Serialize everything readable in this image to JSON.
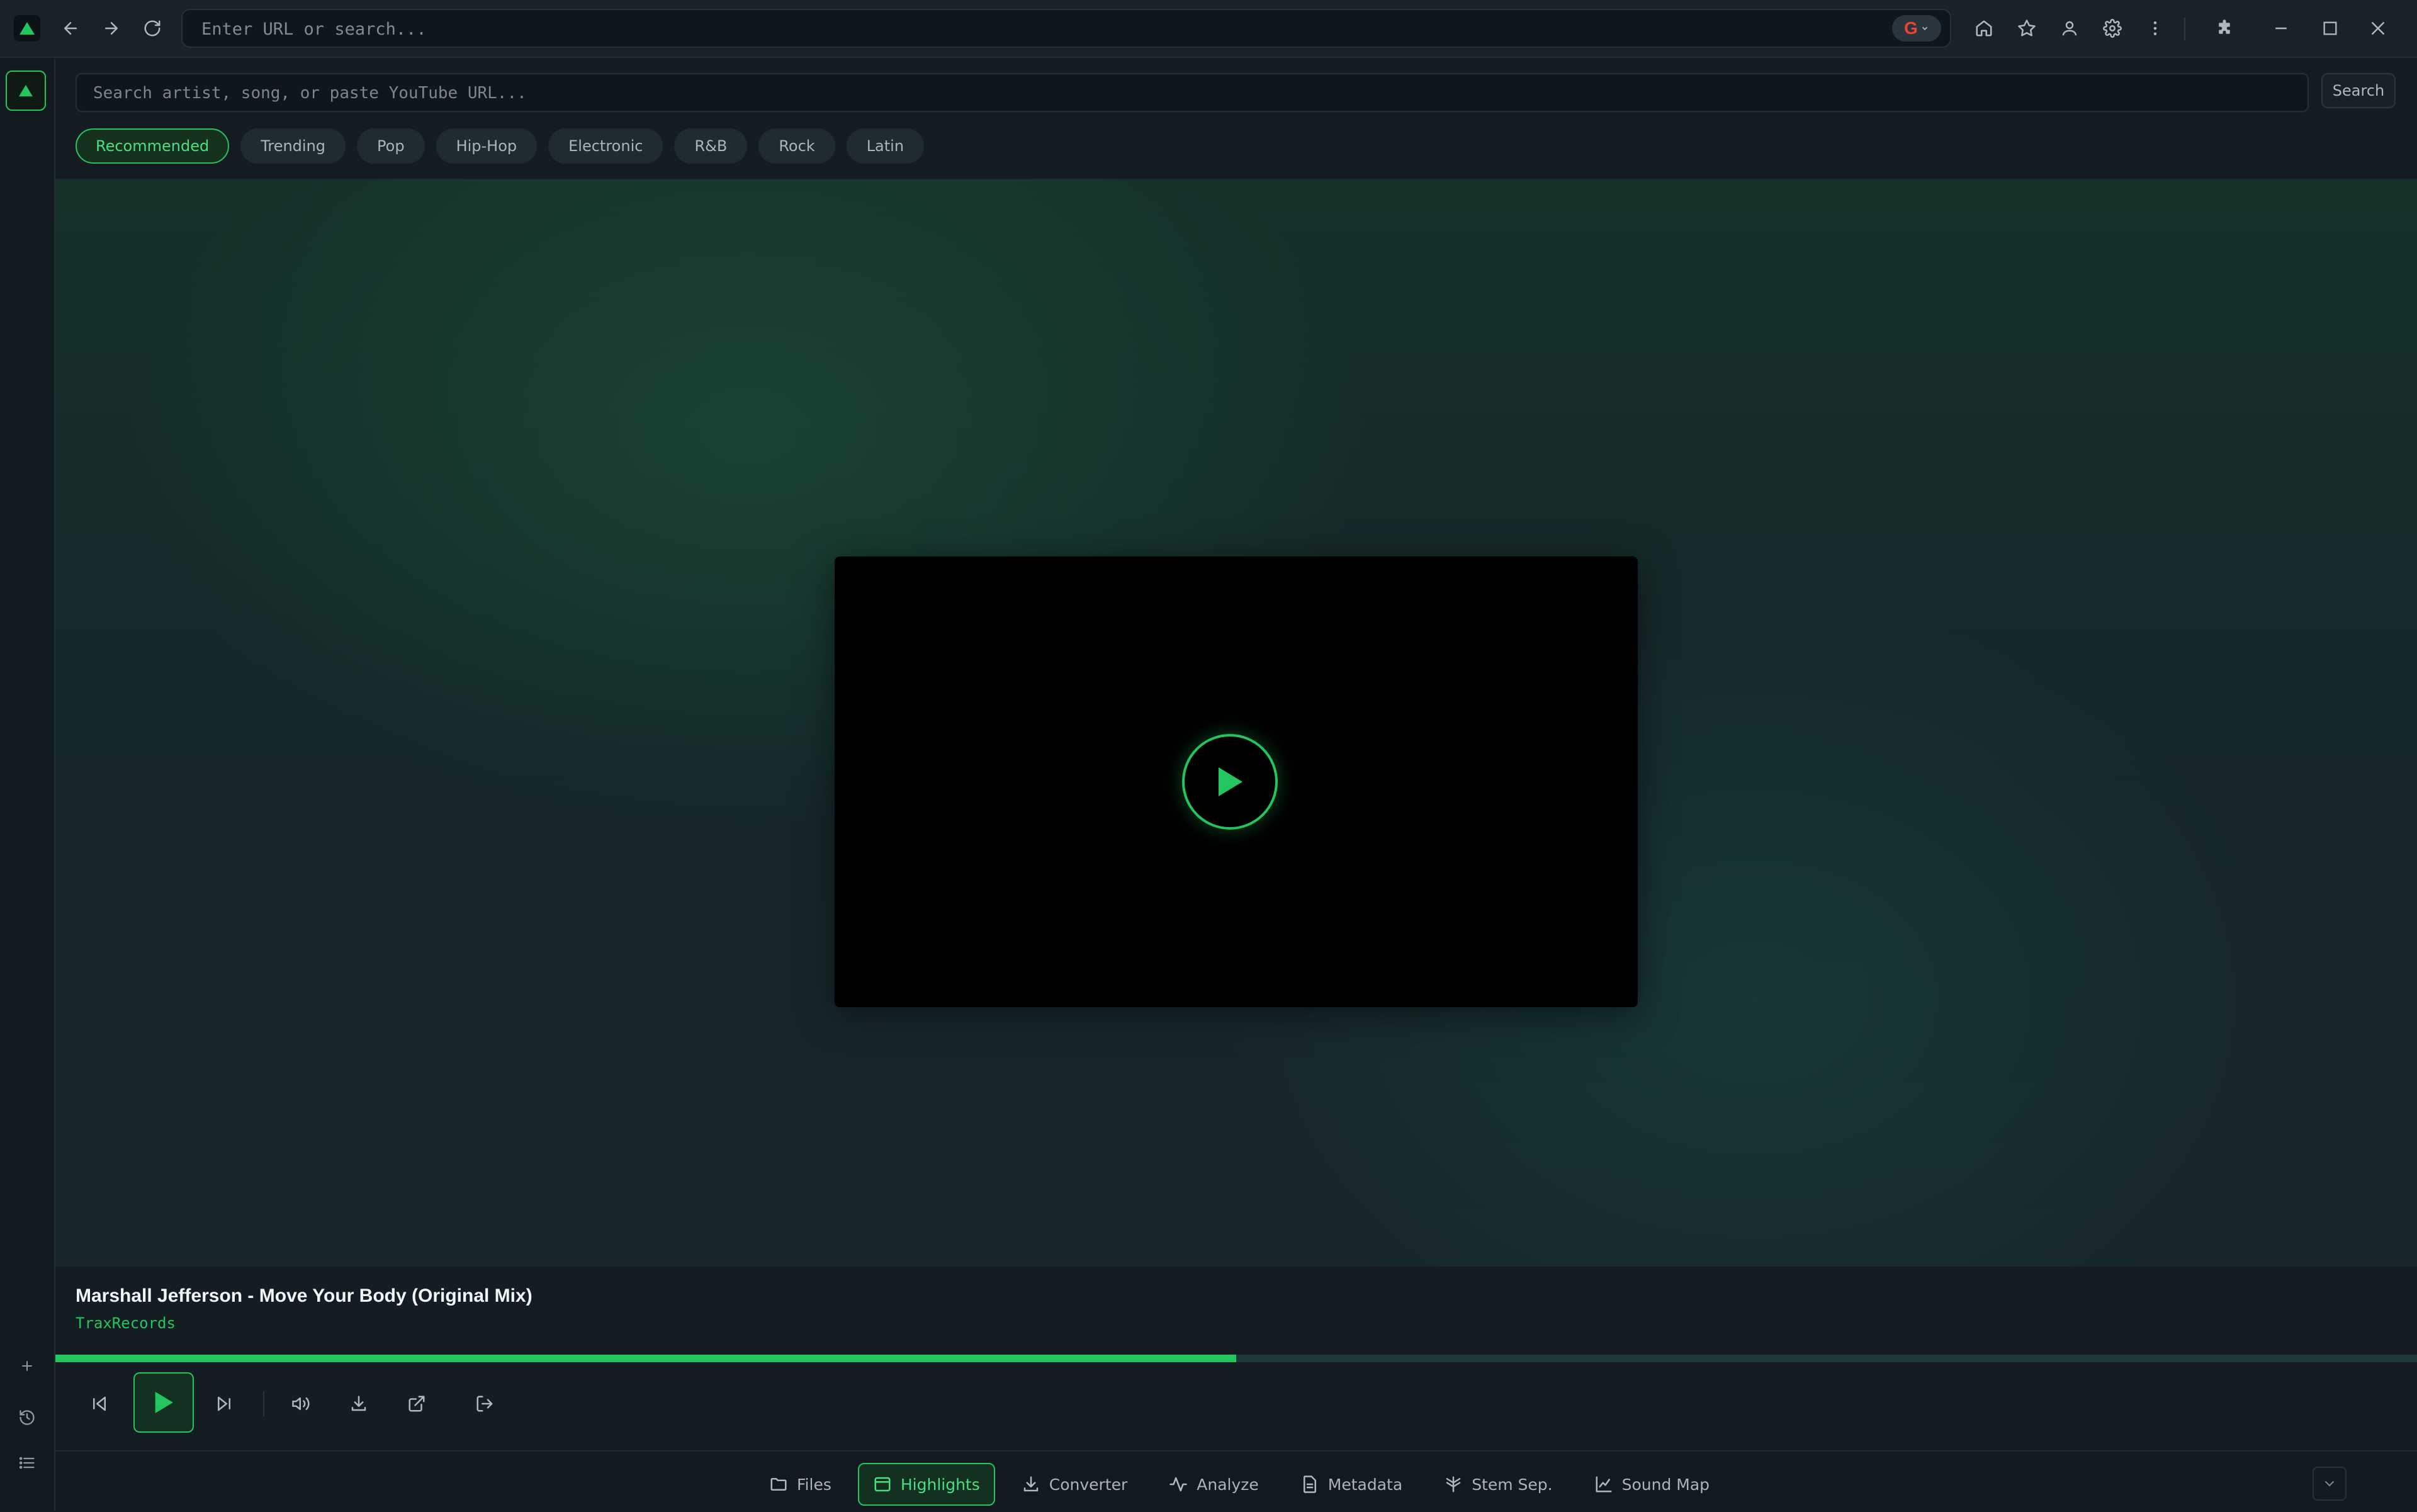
{
  "browser": {
    "url_placeholder": "Enter URL or search...",
    "search_engine": "G"
  },
  "search": {
    "placeholder": "Search artist, song, or paste YouTube URL...",
    "button_label": "Search"
  },
  "genres": [
    {
      "label": "Recommended",
      "active": true
    },
    {
      "label": "Trending"
    },
    {
      "label": "Pop"
    },
    {
      "label": "Hip-Hop"
    },
    {
      "label": "Electronic"
    },
    {
      "label": "R&B"
    },
    {
      "label": "Rock"
    },
    {
      "label": "Latin"
    }
  ],
  "now_playing": {
    "title": "Marshall Jefferson - Move Your Body (Original Mix)",
    "artist": "TraxRecords",
    "progress": 0.5
  },
  "tabs": [
    {
      "label": "Files",
      "icon": "folder-icon"
    },
    {
      "label": "Highlights",
      "icon": "highlights-icon",
      "active": true
    },
    {
      "label": "Converter",
      "icon": "download-icon"
    },
    {
      "label": "Analyze",
      "icon": "pulse-icon"
    },
    {
      "label": "Metadata",
      "icon": "document-icon"
    },
    {
      "label": "Stem Sep.",
      "icon": "split-icon"
    },
    {
      "label": "Sound Map",
      "icon": "chart-icon"
    }
  ],
  "colors": {
    "accent": "#22c55e",
    "background": "#141c22"
  }
}
